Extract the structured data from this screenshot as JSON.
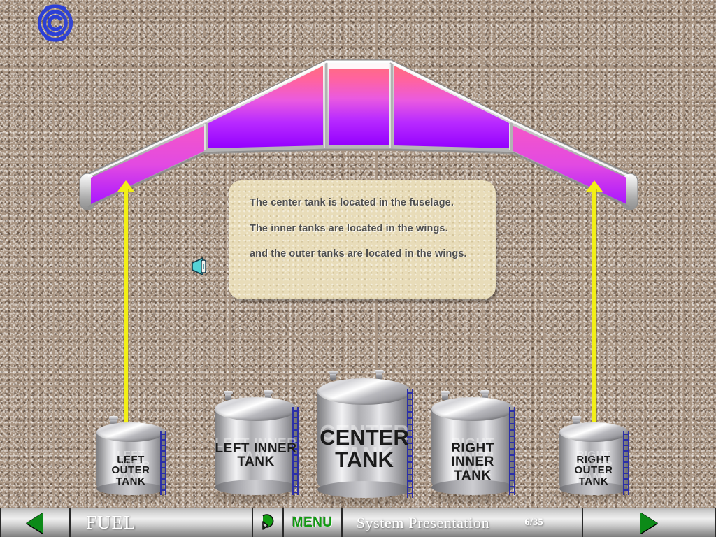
{
  "logo": {
    "icon": "spiral-swirl-logo",
    "color": "#2b3fd6"
  },
  "callout": {
    "lines": [
      "The center tank is located in the fuselage.",
      "The inner tanks are located in the wings.",
      "and the outer tanks are located in the wings."
    ]
  },
  "audio": {
    "icon": "speaker-icon",
    "color": "#4fd4d4"
  },
  "wing": {
    "label": "aircraft-wing-diagram",
    "gradient_top": "#ff6d7d",
    "gradient_bottom": "#9a00ff",
    "frame_color": "#b8b8b8"
  },
  "arrows": {
    "color": "#f2ef17"
  },
  "tanks": [
    {
      "id": "left-outer-tank",
      "label": "LEFT  OUTER\nTANK"
    },
    {
      "id": "left-inner-tank",
      "label": "LEFT  INNER\nTANK"
    },
    {
      "id": "center-tank",
      "label": "CENTER\nTANK"
    },
    {
      "id": "right-inner-tank",
      "label": "RIGHT INNER\nTANK"
    },
    {
      "id": "right-outer-tank",
      "label": "RIGHT  OUTER\nTANK"
    }
  ],
  "toolbar": {
    "prev_icon": "left-triangle-icon",
    "title": "FUEL",
    "replay_icon": "replay-arrow-icon",
    "menu_label": "MENU",
    "section_label": "System  Presentation",
    "page_counter": "6/35",
    "next_icon": "right-triangle-icon",
    "accent_green": "#0c8a18"
  }
}
